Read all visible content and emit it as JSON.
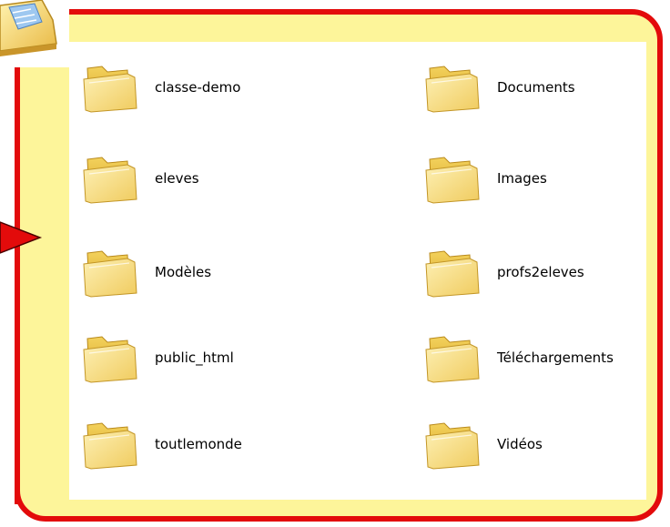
{
  "folders": {
    "left": [
      {
        "name": "classe-demo"
      },
      {
        "name": "eleves"
      },
      {
        "name": "Modèles"
      },
      {
        "name": "public_html"
      },
      {
        "name": "toutlemonde"
      }
    ],
    "right": [
      {
        "name": "Documents"
      },
      {
        "name": "Images"
      },
      {
        "name": "profs2eleves"
      },
      {
        "name": "Téléchargements"
      },
      {
        "name": "Vidéos"
      }
    ]
  },
  "colors": {
    "frame": "#e30b0b",
    "frame_fill": "#fdf59a",
    "folder": "#f7d96a",
    "arrow": "#e30b0b"
  },
  "icons": {
    "folder": "folder-icon",
    "app": "app-icon",
    "pointer": "arrow-right-icon"
  }
}
